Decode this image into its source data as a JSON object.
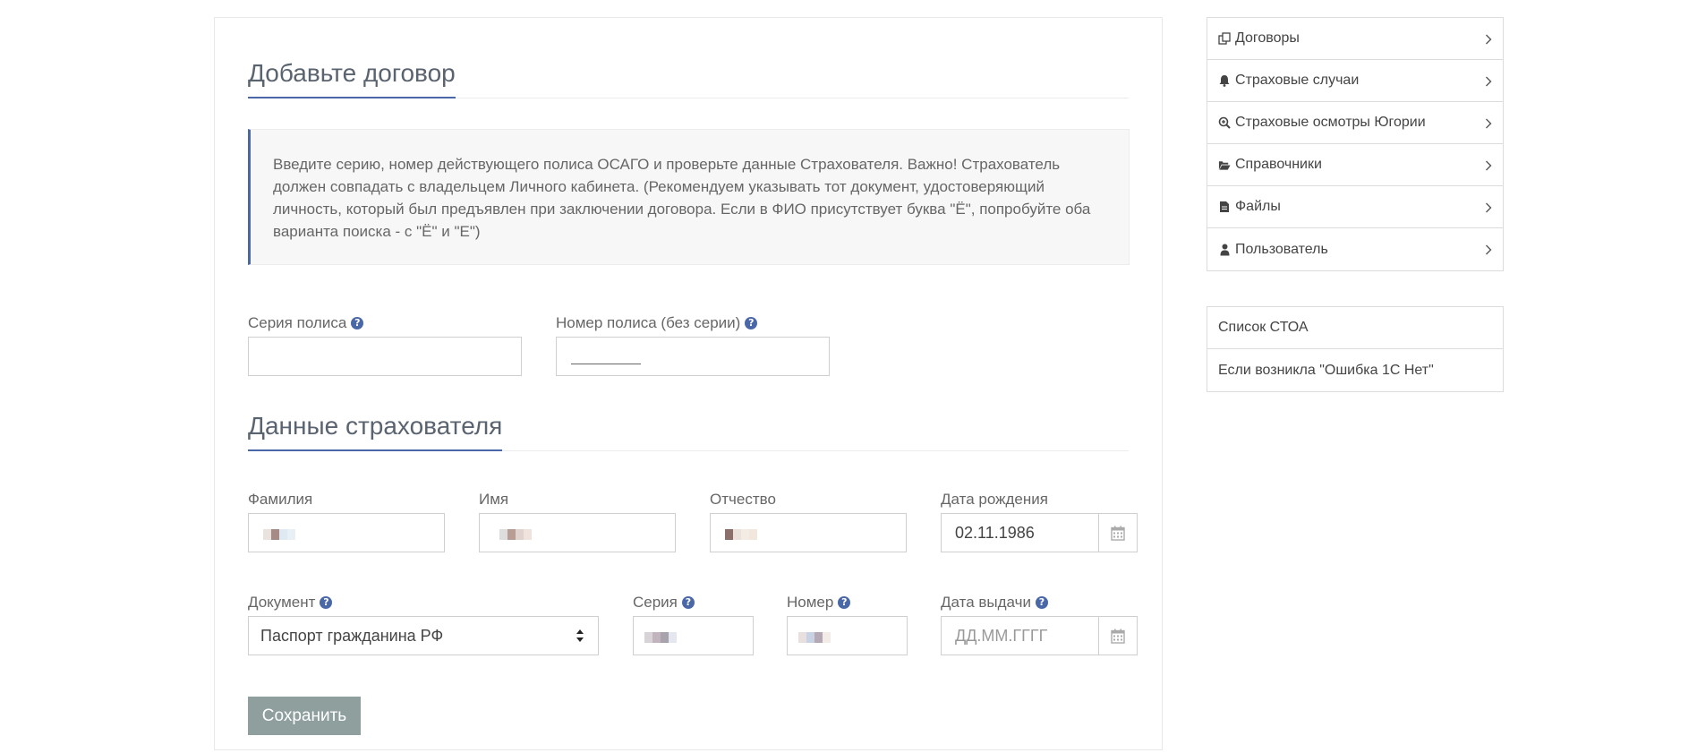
{
  "form": {
    "title": "Добавьте договор",
    "info_text": "Введите серию, номер действующего полиса ОСАГО и проверьте данные Страхователя. Важно! Страхователь должен совпадать с владельцем Личного кабинета. (Рекомендуем указывать тот документ, удостоверяющий личность, который был предъявлен при заключении договора. Если в ФИО присутствует буква \"Ё\", попробуйте оба варианта поиска - с \"Ё\" и \"Е\")",
    "policy_series_label": "Серия полиса",
    "policy_series_value": "",
    "policy_number_label": "Номер полиса (без серии)",
    "policy_number_value": "",
    "insurer_section_title": "Данные страхователя",
    "surname_label": "Фамилия",
    "name_label": "Имя",
    "patronymic_label": "Отчество",
    "birthdate_label": "Дата рождения",
    "birthdate_value": "02.11.1986",
    "document_label": "Документ",
    "document_value": "Паспорт гражданина РФ",
    "doc_series_label": "Серия",
    "doc_number_label": "Номер",
    "issue_date_label": "Дата выдачи",
    "issue_date_placeholder": "ДД.ММ.ГГГГ",
    "help_symbol": "?",
    "save_label": "Сохранить"
  },
  "sidebar": {
    "items": [
      {
        "label": "Договоры",
        "icon": "copy-icon"
      },
      {
        "label": "Страховые случаи",
        "icon": "bell-icon"
      },
      {
        "label": "Страховые осмотры Югории",
        "icon": "search-plus-icon"
      },
      {
        "label": "Справочники",
        "icon": "folder-open-icon"
      },
      {
        "label": "Файлы",
        "icon": "file-icon"
      },
      {
        "label": "Пользователь",
        "icon": "user-icon"
      }
    ],
    "links": [
      {
        "label": "Список СТОА"
      },
      {
        "label": "Если возникла \"Ошибка 1С Нет\""
      }
    ]
  },
  "colors": {
    "accent": "#4a67a8",
    "button_bg": "#8f9f9e",
    "border": "#cfcfcf"
  }
}
